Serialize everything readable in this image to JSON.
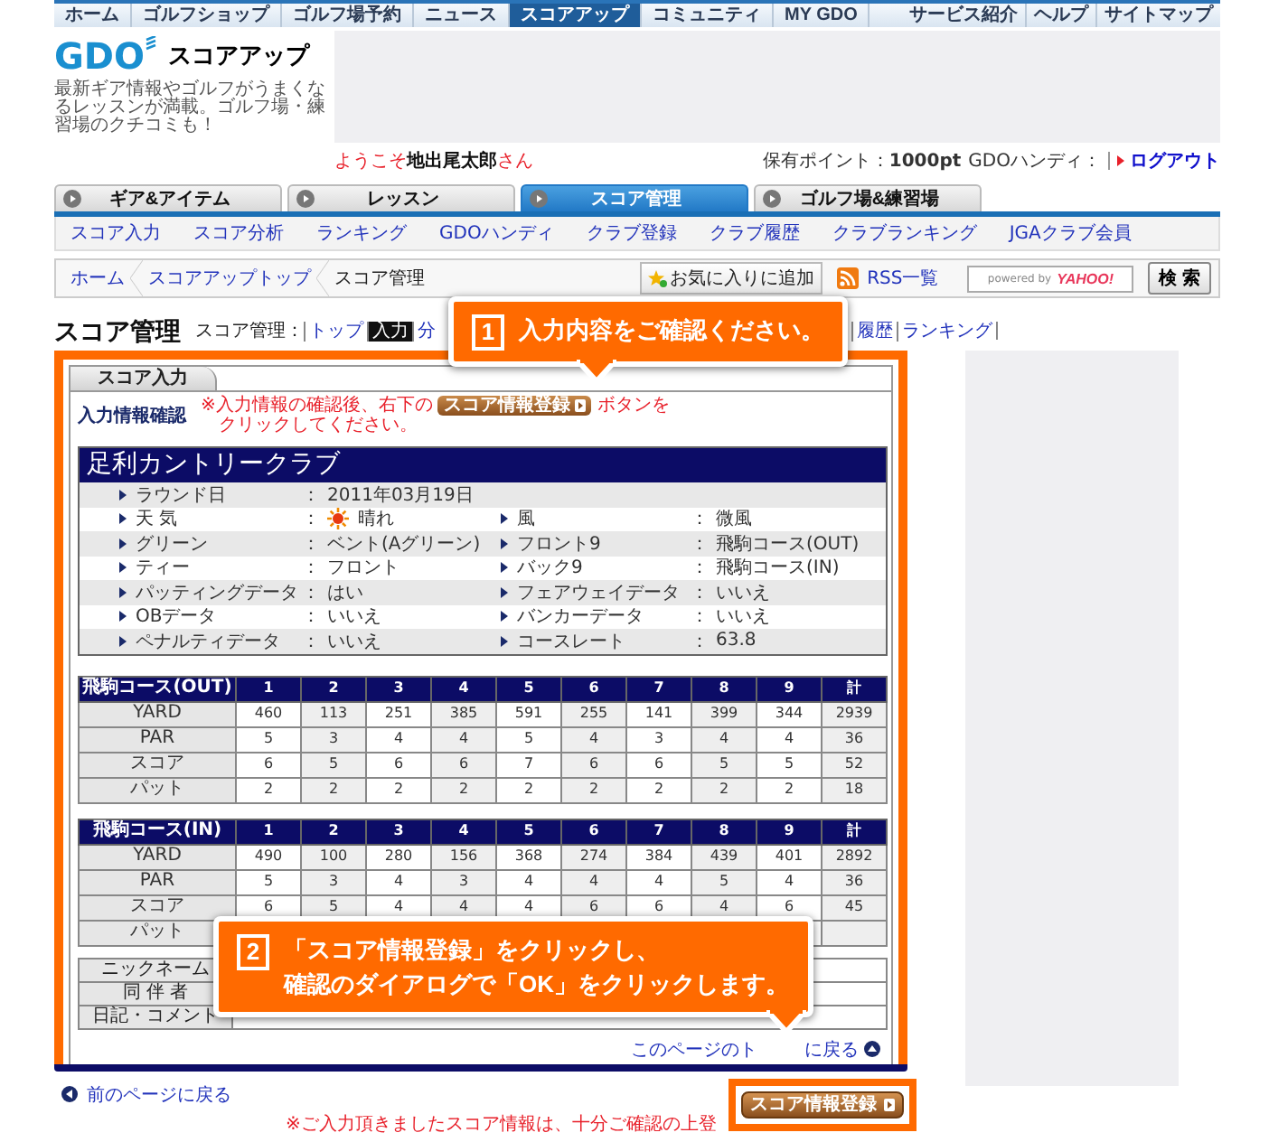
{
  "top_nav": {
    "items": [
      {
        "label": "ホーム",
        "selected": false
      },
      {
        "label": "ゴルフショップ",
        "selected": false
      },
      {
        "label": "ゴルフ場予約",
        "selected": false
      },
      {
        "label": "ニュース",
        "selected": false
      },
      {
        "label": "スコアアップ",
        "selected": true
      },
      {
        "label": "コミュニティ",
        "selected": false
      },
      {
        "label": "MY GDO",
        "selected": false
      }
    ],
    "links": [
      "サービス紹介",
      "ヘルプ",
      "サイトマップ"
    ]
  },
  "header": {
    "logo": "GDO",
    "site_name": "スコアアップ",
    "tagline": "最新ギア情報やゴルフがうまくなるレッスンが満載。ゴルフ場・練習場のクチコミも！",
    "welcome": "ようこそ**地出尾太郎**さん",
    "points": "保有ポイント：**1000pt**",
    "handicap": "GDOハンディ：",
    "logout": "ログアウト"
  },
  "section_tabs": [
    {
      "label": "ギア&アイテム",
      "selected": false
    },
    {
      "label": "レッスン",
      "selected": false
    },
    {
      "label": "スコア管理",
      "selected": true
    },
    {
      "label": "ゴルフ場&練習場",
      "selected": false
    }
  ],
  "sub_menu": [
    "スコア入力",
    "スコア分析",
    "ランキング",
    "GDOハンディ",
    "クラブ登録",
    "クラブ履歴",
    "クラブランキング",
    "JGAクラブ会員"
  ],
  "breadcrumb": {
    "items": [
      "ホーム",
      "スコアアップトップ",
      "スコア管理"
    ],
    "favorite": "お気に入りに追加",
    "rss": "RSS一覧",
    "powered_by": "powered by",
    "search_logo": "YAHOO!",
    "search_button": "検 索"
  },
  "page_title": "スコア管理",
  "page_menu": {
    "label": "スコア管理：",
    "left": [
      {
        "label": "トップ",
        "selected": false
      },
      {
        "label": "入力",
        "selected": true
      },
      {
        "label": "分",
        "selected": false
      }
    ],
    "right": [
      {
        "label": "履歴",
        "selected": false
      },
      {
        "label": "ランキング",
        "selected": false
      }
    ]
  },
  "panel": {
    "tab": "スコア入力",
    "confirm_label": "入力情報確認",
    "note_before": "※入力情報の確認後、右下の",
    "note_button": "スコア情報登録",
    "note_after": "ボタンを",
    "note_line2": "クリックしてください。"
  },
  "round": {
    "course": "足利カントリークラブ",
    "rows": [
      {
        "left": {
          "label": "ラウンド日",
          "sep": "：",
          "value": "2011年03月19日",
          "kind": "text"
        }
      },
      {
        "left": {
          "label": "天 気",
          "sep": "：",
          "value": "晴れ",
          "kind": "sunny"
        },
        "right": {
          "label": "風",
          "sep": "：",
          "value": "微風",
          "kind": "text"
        }
      },
      {
        "left": {
          "label": "グリーン",
          "sep": "：",
          "value": "ベント(Aグリーン)",
          "kind": "text"
        },
        "right": {
          "label": "フロント9",
          "sep": "：",
          "value": "飛駒コース(OUT)",
          "kind": "text"
        }
      },
      {
        "left": {
          "label": "ティー",
          "sep": "：",
          "value": "フロント",
          "kind": "text"
        },
        "right": {
          "label": "バック9",
          "sep": "：",
          "value": "飛駒コース(IN)",
          "kind": "text"
        }
      },
      {
        "left": {
          "label": "パッティングデータ",
          "sep": "：",
          "value": "はい",
          "kind": "text"
        },
        "right": {
          "label": "フェアウェイデータ",
          "sep": "：",
          "value": "いいえ",
          "kind": "text"
        }
      },
      {
        "left": {
          "label": "OBデータ",
          "sep": "：",
          "value": "いいえ",
          "kind": "text"
        },
        "right": {
          "label": "バンカーデータ",
          "sep": "：",
          "value": "いいえ",
          "kind": "text"
        }
      },
      {
        "left": {
          "label": "ペナルティデータ",
          "sep": "：",
          "value": "いいえ",
          "kind": "text"
        },
        "right": {
          "label": "コースレート",
          "sep": "：",
          "value": "63.8",
          "kind": "text"
        }
      }
    ]
  },
  "score_tables": [
    {
      "title": "飛駒コース(OUT)",
      "columns": [
        "1",
        "2",
        "3",
        "4",
        "5",
        "6",
        "7",
        "8",
        "9",
        "計"
      ],
      "rows": [
        {
          "label": "YARD",
          "values": [
            "460",
            "113",
            "251",
            "385",
            "591",
            "255",
            "141",
            "399",
            "344",
            "2939"
          ]
        },
        {
          "label": "PAR",
          "values": [
            "5",
            "3",
            "4",
            "4",
            "5",
            "4",
            "3",
            "4",
            "4",
            "36"
          ]
        },
        {
          "label": "スコア",
          "values": [
            "6",
            "5",
            "6",
            "6",
            "7",
            "6",
            "6",
            "5",
            "5",
            "52"
          ]
        },
        {
          "label": "パット",
          "values": [
            "2",
            "2",
            "2",
            "2",
            "2",
            "2",
            "2",
            "2",
            "2",
            "18"
          ]
        }
      ]
    },
    {
      "title": "飛駒コース(IN)",
      "columns": [
        "1",
        "2",
        "3",
        "4",
        "5",
        "6",
        "7",
        "8",
        "9",
        "計"
      ],
      "rows": [
        {
          "label": "YARD",
          "values": [
            "490",
            "100",
            "280",
            "156",
            "368",
            "274",
            "384",
            "439",
            "401",
            "2892"
          ]
        },
        {
          "label": "PAR",
          "values": [
            "5",
            "3",
            "4",
            "3",
            "4",
            "4",
            "4",
            "5",
            "4",
            "36"
          ]
        },
        {
          "label": "スコア",
          "values": [
            "6",
            "5",
            "4",
            "4",
            "4",
            "6",
            "6",
            "4",
            "6",
            "45"
          ]
        },
        {
          "label": "パット"
        }
      ]
    }
  ],
  "details": [
    {
      "label": "ニックネーム"
    },
    {
      "label": "同 伴 者"
    },
    {
      "label": "日記・コメント"
    }
  ],
  "back_to_top": {
    "before": "このページのト",
    "after": "に戻る"
  },
  "callouts": [
    {
      "number": "1",
      "lines": [
        "入力内容をご確認ください。"
      ]
    },
    {
      "number": "2",
      "lines": [
        "「スコア情報登録」をクリックし、",
        "確認のダイアログで「OK」をクリックします。"
      ]
    }
  ],
  "footer": {
    "back": "前のページに戻る",
    "register_button": "スコア情報登録",
    "notice": "※ご入力頂きましたスコア情報は、十分ご確認の上登"
  }
}
